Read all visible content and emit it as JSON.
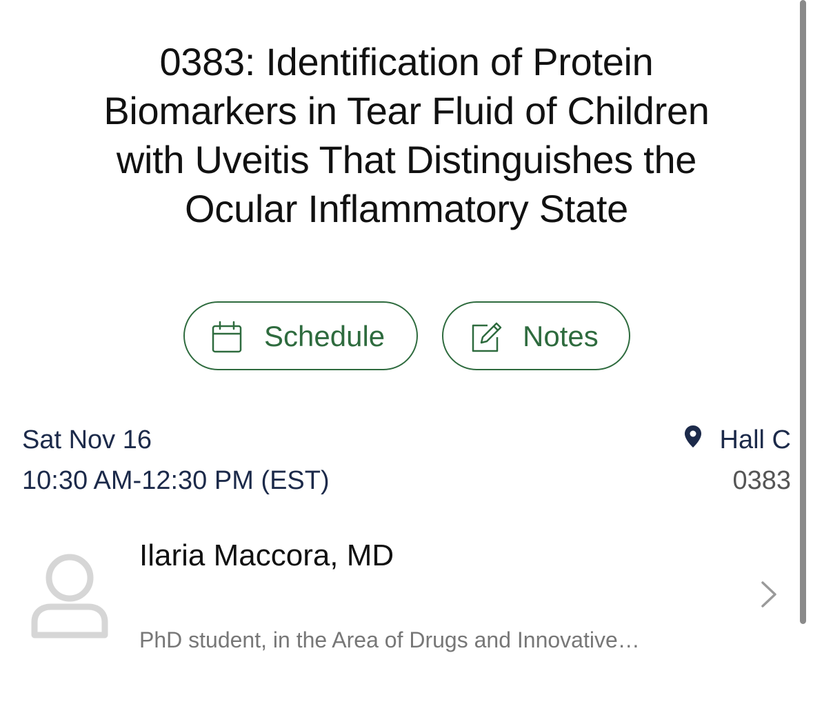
{
  "session": {
    "title": "0383: Identification of Protein Biomarkers in Tear Fluid of Children with Uveitis That Distinguishes the Ocular Inflammatory State"
  },
  "actions": {
    "schedule_label": "Schedule",
    "schedule_icon": "calendar-icon",
    "notes_label": "Notes",
    "notes_icon": "edit-note-icon",
    "accent_color": "#2e6b3e"
  },
  "details": {
    "date": "Sat Nov 16",
    "time": "10:30 AM-12:30 PM (EST)",
    "location": "Hall C",
    "location_icon": "map-pin-icon",
    "code": "0383"
  },
  "author": {
    "name": "Ilaria Maccora, MD",
    "affiliation": "PhD student, in the Area of Drugs and Innovative…",
    "avatar_icon": "user-avatar-icon",
    "chevron_icon": "chevron-right-icon"
  }
}
